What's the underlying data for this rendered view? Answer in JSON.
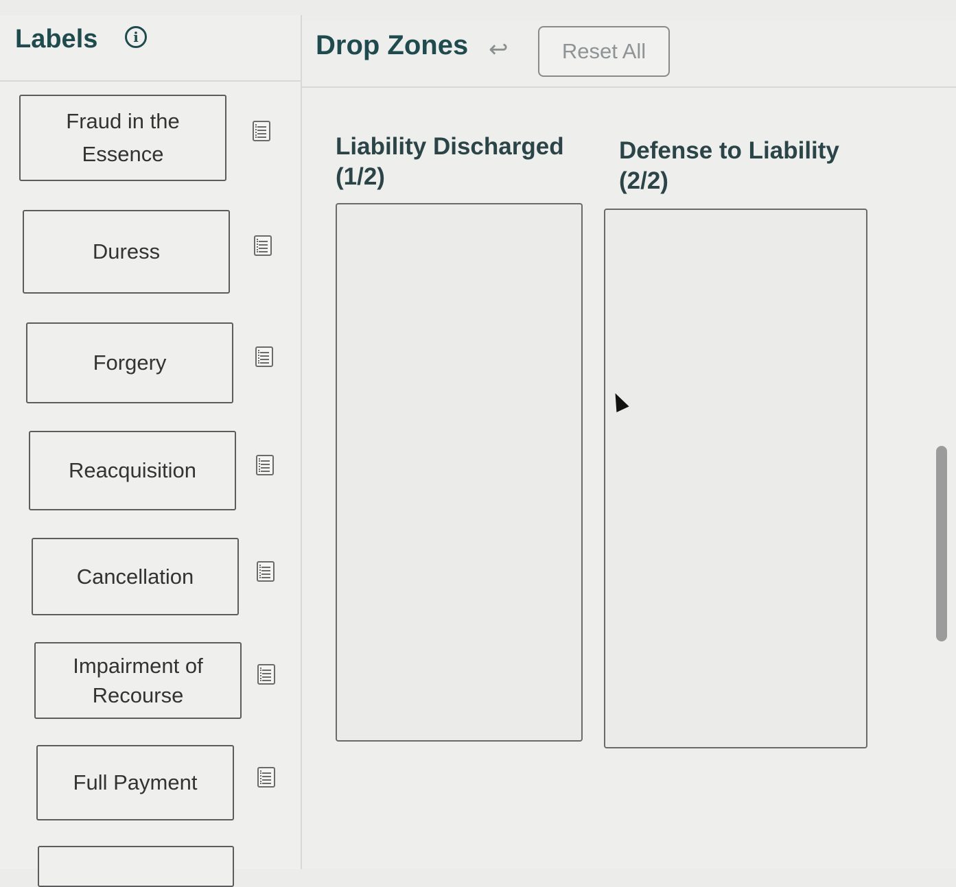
{
  "labels_panel": {
    "title": "Labels",
    "items": [
      {
        "label": "Fraud in the Essence"
      },
      {
        "label": "Duress"
      },
      {
        "label": "Forgery"
      },
      {
        "label": "Reacquisition"
      },
      {
        "label": "Cancellation"
      },
      {
        "label": "Impairment of Recourse"
      },
      {
        "label": "Full Payment"
      },
      {
        "label": ""
      }
    ]
  },
  "drop_zones_panel": {
    "title": "Drop Zones",
    "reset_label": "Reset All",
    "zones": [
      {
        "name": "Liability Discharged",
        "count": "(1/2)"
      },
      {
        "name": "Defense to Liability",
        "count": "(2/2)"
      }
    ]
  },
  "colors": {
    "heading": "#1f4a4e",
    "border": "#5c5c5c"
  },
  "icons": {
    "info": "info-icon",
    "item": "document-icon",
    "back": "undo-arrow-icon"
  }
}
